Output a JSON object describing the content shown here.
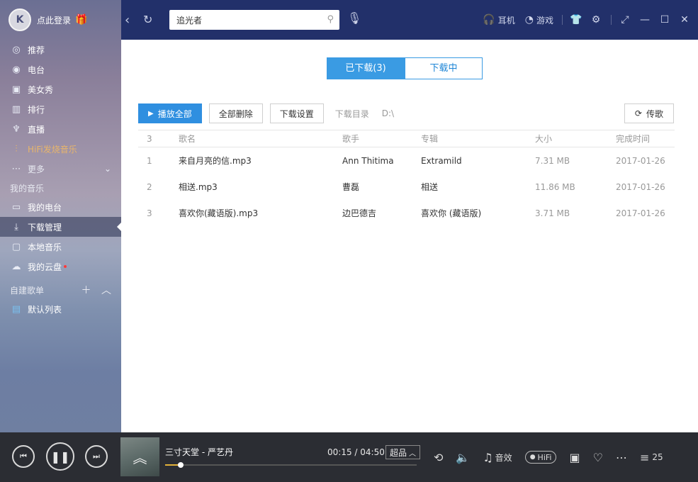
{
  "header": {
    "login_text": "点此登录",
    "search_value": "追光者",
    "links": [
      {
        "icon": "headphones-icon",
        "label": "耳机"
      },
      {
        "icon": "game-icon",
        "label": "游戏"
      }
    ]
  },
  "sidebar": {
    "items": [
      {
        "label": "推荐",
        "icon": "recommend-icon"
      },
      {
        "label": "电台",
        "icon": "radio-icon"
      },
      {
        "label": "美女秀",
        "icon": "video-icon"
      },
      {
        "label": "排行",
        "icon": "chart-icon"
      },
      {
        "label": "直播",
        "icon": "mic-icon"
      },
      {
        "label": "HiFi发烧音乐",
        "icon": "hifi-wave-icon"
      },
      {
        "label": "更多",
        "icon": "more-dots-icon"
      }
    ],
    "my_music_title": "我的音乐",
    "my_items": [
      {
        "label": "我的电台"
      },
      {
        "label": "下载管理"
      },
      {
        "label": "本地音乐"
      },
      {
        "label": "我的云盘"
      }
    ],
    "playlist_title": "自建歌单",
    "playlist_items": [
      {
        "label": "默认列表"
      }
    ]
  },
  "main": {
    "tabs": [
      {
        "label": "已下载(3)",
        "active": true
      },
      {
        "label": "下载中",
        "active": false
      }
    ],
    "toolbar": {
      "play_all": "播放全部",
      "delete_all": "全部删除",
      "download_settings": "下载设置",
      "dir_label": "下载目录",
      "dir_value": "D:\\",
      "transfer": "传歌"
    },
    "table": {
      "headers": {
        "count": "3",
        "name": "歌名",
        "artist": "歌手",
        "album": "专辑",
        "size": "大小",
        "time": "完成时间"
      },
      "rows": [
        {
          "idx": "1",
          "name": "来自月亮的信.mp3",
          "artist": "Ann Thitima",
          "album": "Extramild",
          "size": "7.31 MB",
          "time": "2017-01-26"
        },
        {
          "idx": "2",
          "name": "相送.mp3",
          "artist": "曹磊",
          "album": "相送",
          "size": "11.86 MB",
          "time": "2017-01-26"
        },
        {
          "idx": "3",
          "name": "喜欢你(藏语版).mp3",
          "artist": "边巴德吉",
          "album": "喜欢你 (藏语版)",
          "size": "3.71 MB",
          "time": "2017-01-26"
        }
      ]
    }
  },
  "player": {
    "song_title": "三寸天堂 - 严艺丹",
    "current_time": "00:15",
    "total_time": "04:50",
    "time_separator": " / ",
    "quality": "超品",
    "progress": 0.062,
    "effects_label": "音效",
    "hifi_label": "HiFi",
    "playlist_count": "25"
  },
  "colors": {
    "topbar": "#22306a",
    "accent": "#3a9be3",
    "progress": "#e3b23a",
    "hifi_text": "#e8b56b"
  }
}
